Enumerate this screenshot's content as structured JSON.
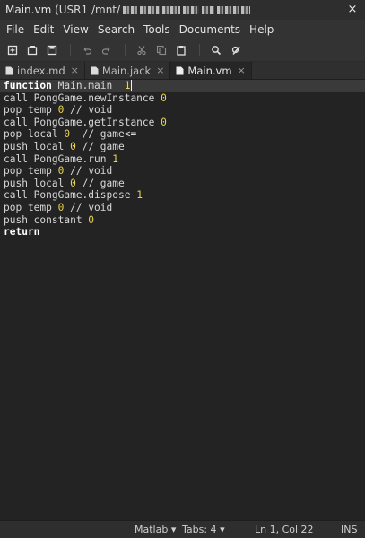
{
  "window": {
    "title": "Main.vm",
    "path_prefix": "(USR1 /mnt/",
    "close_glyph": "×"
  },
  "menu": [
    "File",
    "Edit",
    "View",
    "Search",
    "Tools",
    "Documents",
    "Help"
  ],
  "toolbar": {
    "icons": [
      "new-document-icon",
      "open-icon",
      "save-icon",
      "undo-icon",
      "redo-icon",
      "cut-icon",
      "copy-icon",
      "paste-icon",
      "find-icon",
      "replace-icon"
    ]
  },
  "tabs": [
    {
      "label": "index.md",
      "close": "×",
      "active": false
    },
    {
      "label": "Main.jack",
      "close": "×",
      "active": false
    },
    {
      "label": "Main.vm",
      "close": "×",
      "active": true
    }
  ],
  "code": [
    [
      {
        "t": "function",
        "c": "kw"
      },
      {
        "t": " Main.main  ",
        "c": ""
      },
      {
        "t": "1",
        "c": "num"
      }
    ],
    [
      {
        "t": "call PongGame.newInstance ",
        "c": ""
      },
      {
        "t": "0",
        "c": "num"
      }
    ],
    [
      {
        "t": "pop temp ",
        "c": ""
      },
      {
        "t": "0",
        "c": "num"
      },
      {
        "t": " // void",
        "c": ""
      }
    ],
    [
      {
        "t": "call PongGame.getInstance ",
        "c": ""
      },
      {
        "t": "0",
        "c": "num"
      }
    ],
    [
      {
        "t": "pop local ",
        "c": ""
      },
      {
        "t": "0",
        "c": "num"
      },
      {
        "t": "  // game<=",
        "c": ""
      }
    ],
    [
      {
        "t": "push local ",
        "c": ""
      },
      {
        "t": "0",
        "c": "num"
      },
      {
        "t": " // game",
        "c": ""
      }
    ],
    [
      {
        "t": "call PongGame.run ",
        "c": ""
      },
      {
        "t": "1",
        "c": "num"
      }
    ],
    [
      {
        "t": "pop temp ",
        "c": ""
      },
      {
        "t": "0",
        "c": "num"
      },
      {
        "t": " // void",
        "c": ""
      }
    ],
    [
      {
        "t": "push local ",
        "c": ""
      },
      {
        "t": "0",
        "c": "num"
      },
      {
        "t": " // game",
        "c": ""
      }
    ],
    [
      {
        "t": "call PongGame.dispose ",
        "c": ""
      },
      {
        "t": "1",
        "c": "num"
      }
    ],
    [
      {
        "t": "pop temp ",
        "c": ""
      },
      {
        "t": "0",
        "c": "num"
      },
      {
        "t": " // void",
        "c": ""
      }
    ],
    [
      {
        "t": "push constant ",
        "c": ""
      },
      {
        "t": "0",
        "c": "num"
      }
    ],
    [
      {
        "t": "return",
        "c": "kw"
      }
    ]
  ],
  "status": {
    "language": "Matlab",
    "language_arrow": "▾",
    "tabs": "Tabs: 4",
    "tabs_arrow": "▾",
    "position": "Ln 1, Col 22",
    "mode": "INS"
  },
  "colors": {
    "number": "#e8d44d",
    "keyword": "#ffffff",
    "editor_bg": "#232323",
    "current_line": "#3a3a3a"
  }
}
